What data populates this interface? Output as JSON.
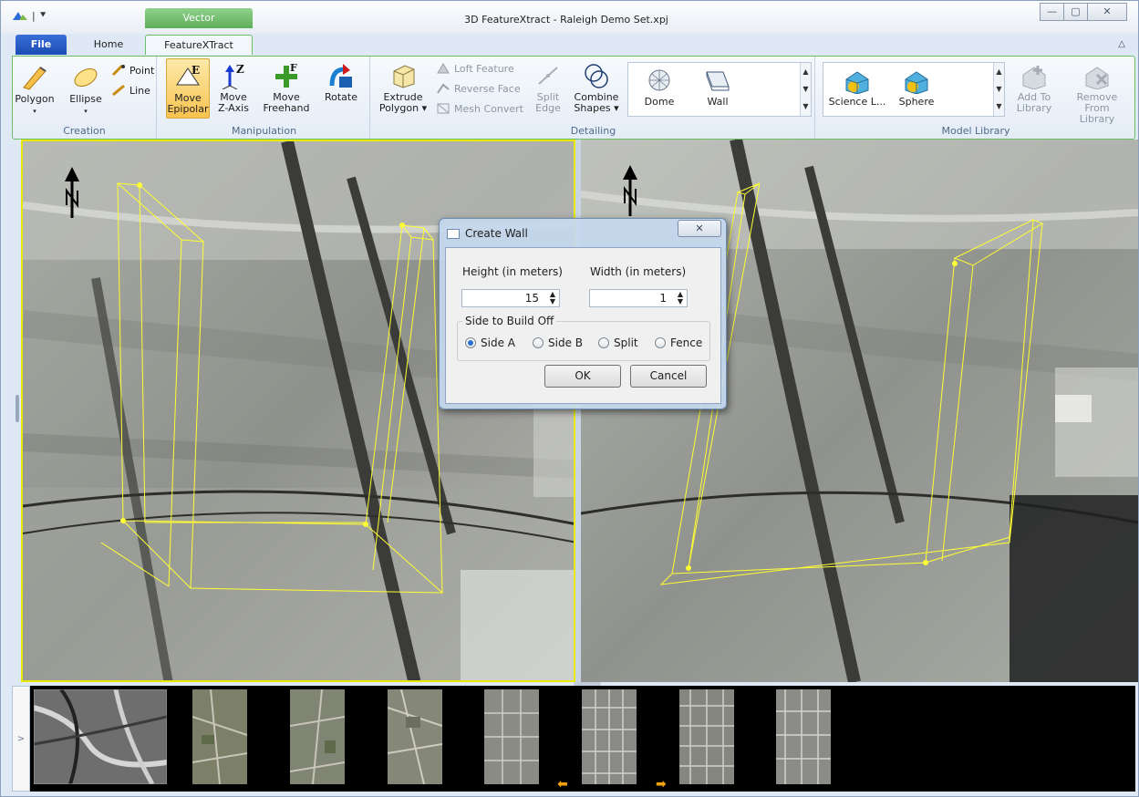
{
  "window": {
    "title": "3D FeatureXtract - Raleigh Demo Set.xpj",
    "context_tab": "Vector",
    "controls": [
      "—",
      "▢",
      "✕"
    ]
  },
  "tabs": {
    "file": "File",
    "home": "Home",
    "featurextract": "FeatureXTract",
    "minimize": "△"
  },
  "ribbon": {
    "creation": {
      "label": "Creation",
      "polygon": "Polygon",
      "ellipse": "Ellipse",
      "point": "Point",
      "line": "Line"
    },
    "manipulation": {
      "label": "Manipulation",
      "move_epipolar": [
        "Move",
        "Epipolar"
      ],
      "move_zaxis": [
        "Move",
        "Z-Axis"
      ],
      "move_freehand": [
        "Move",
        "Freehand"
      ],
      "rotate": "Rotate"
    },
    "detailing": {
      "label": "Detailing",
      "extrude": [
        "Extrude",
        "Polygon ▾"
      ],
      "loft": "Loft Feature",
      "reverse": "Reverse Face",
      "mesh": "Mesh Convert",
      "split": [
        "Split",
        "Edge"
      ],
      "combine": [
        "Combine",
        "Shapes ▾"
      ],
      "dome": "Dome",
      "wall": "Wall"
    },
    "library": {
      "label": "Model Library",
      "science": "Science L...",
      "sphere": "Sphere",
      "add": [
        "Add To",
        "Library"
      ],
      "remove": [
        "Remove From",
        "Library"
      ]
    }
  },
  "dialog": {
    "title": "Create Wall",
    "close": "✕",
    "height_label": "Height (in meters)",
    "height_value": "15",
    "width_label": "Width (in meters)",
    "width_value": "1",
    "group_label": "Side to Build Off",
    "options": [
      "Side A",
      "Side B",
      "Split",
      "Fence"
    ],
    "selected_option": "Side A",
    "ok": "OK",
    "cancel": "Cancel"
  },
  "filmstrip": {
    "expander": ">",
    "thumb_count": 8
  },
  "colors": {
    "wireframe": "#ffff33",
    "selection": "#e8e800",
    "ribbon_active": "#f8c34f"
  }
}
